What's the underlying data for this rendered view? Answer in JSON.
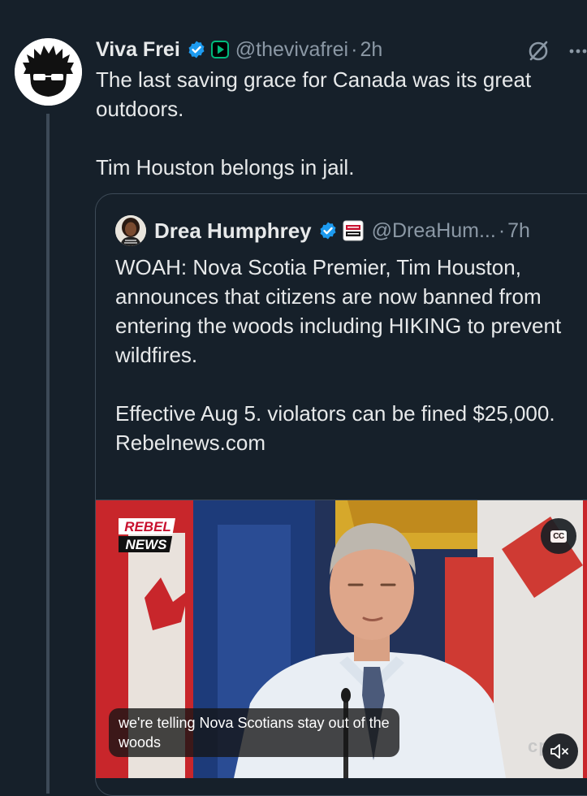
{
  "author": {
    "name": "Viva Frei",
    "handle": "@thevivafrei",
    "separator": "·",
    "time": "2h",
    "avatar_icon": "wild-hair-sunglasses-avatar-icon",
    "verified_icon": "verified-badge-icon",
    "affiliate_icon": "green-play-badge-icon"
  },
  "tweet": {
    "text": "The last saving grace for Canada was its great outdoors.\n\nTim Houston belongs in jail."
  },
  "actions": {
    "grok_icon": "grok-icon",
    "more_icon": "more-dots-icon"
  },
  "quote": {
    "name": "Drea Humphrey",
    "handle": "@DreaHum...",
    "separator": "·",
    "time": "7h",
    "verified_icon": "verified-badge-icon",
    "affiliate_icon": "rebel-news-badge-icon",
    "text": "WOAH: Nova Scotia Premier, Tim Houston, announces that citizens are now banned from entering the woods including HIKING to prevent wildfires.\n\nEffective Aug 5. violators can be fined $25,000.\nRebelnews.com"
  },
  "media": {
    "logo_line1": "REBEL",
    "logo_line2": "NEWS",
    "cc_label": "CC",
    "caption": "we're telling Nova Scotians stay out of the woods",
    "network_mark": "cpac",
    "mute_icon": "speaker-muted-icon"
  },
  "colors": {
    "background": "#16202a",
    "text": "#e7e9ea",
    "secondary": "#8b98a5",
    "verified_blue": "#1d9bf0",
    "affiliate_green": "#00ba7c"
  }
}
